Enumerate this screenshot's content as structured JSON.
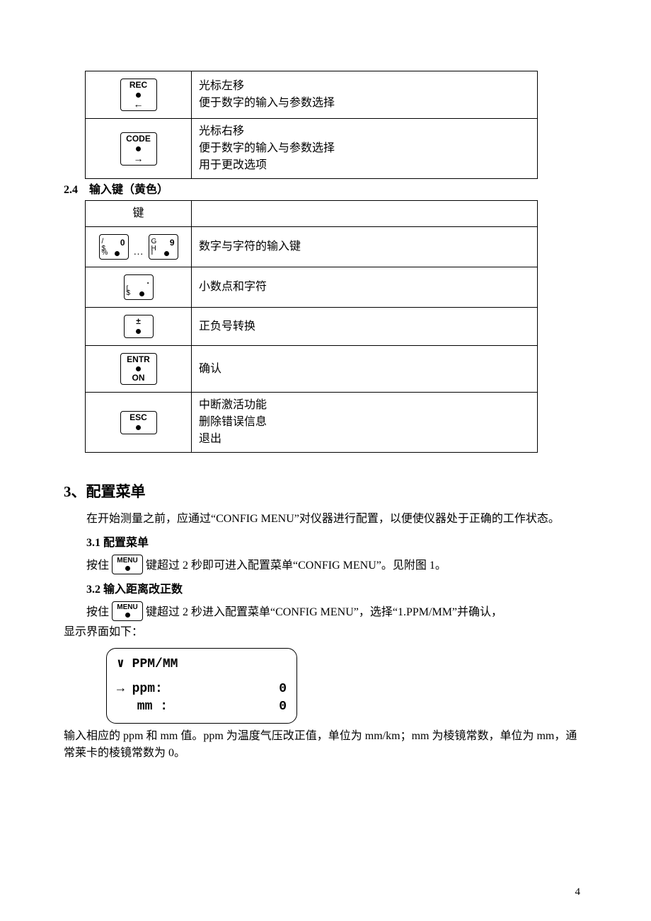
{
  "table1": {
    "rows": [
      {
        "key_label": "REC",
        "key_sub_arrow": "←",
        "desc": "光标左移\n便于数字的输入与参数选择"
      },
      {
        "key_label": "CODE",
        "key_sub_arrow": "→",
        "desc": "光标右移\n便于数字的输入与参数选择\n用于更改选项"
      }
    ]
  },
  "section_2_4": "2.4　输入键（黄色）",
  "table2": {
    "header_left": "键",
    "header_right": "",
    "rows": [
      {
        "kind": "numkeys",
        "keys": [
          {
            "tl": "/",
            "ml": "$",
            "bl": "%",
            "tr": "0"
          },
          {
            "tl": "G",
            "ml": "H",
            "bl": "I",
            "tr": "9"
          }
        ],
        "ellipsis": "…",
        "desc": "数字与字符的输入键"
      },
      {
        "kind": "numkey-single",
        "key": {
          "tl": "",
          "ml": "[",
          "bl": "$",
          "tr": "·"
        },
        "desc": "小数点和字符"
      },
      {
        "kind": "simple-sym",
        "sym": "±",
        "desc": "正负号转换"
      },
      {
        "kind": "entr",
        "top": "ENTR",
        "bot": "ON",
        "desc": "确认"
      },
      {
        "kind": "esc",
        "label": "ESC",
        "desc": "中断激活功能\n删除错误信息\n退出"
      }
    ]
  },
  "h3_title": "3、配置菜单",
  "p3_intro": "在开始测量之前，应通过“CONFIG MENU”对仪器进行配置，以便使仪器处于正确的工作状态。",
  "s3_1_head": "3.1 配置菜单",
  "menu_key_label": "MENU",
  "s3_1_before": "按住",
  "s3_1_after": "键超过 2 秒即可进入配置菜单“CONFIG MENU”。见附图 1。",
  "s3_2_head": "3.2 输入距离改正数",
  "s3_2_before": "按住",
  "s3_2_after": "键超过 2 秒进入配置菜单“CONFIG MENU”，选择“1.PPM/MM”并确认，",
  "s3_2_line2": "显示界面如下：",
  "lcd": {
    "title": "∨ PPM/MM",
    "rows": [
      {
        "label": "→ ppm:",
        "value": "0"
      },
      {
        "label": "　 mm :",
        "value": "0"
      }
    ]
  },
  "p3_2_tail": "输入相应的 ppm 和 mm 值。ppm 为温度气压改正值，单位为 mm/km；mm 为棱镜常数，单位为 mm，通常莱卡的棱镜常数为 0。",
  "page_number": "4"
}
